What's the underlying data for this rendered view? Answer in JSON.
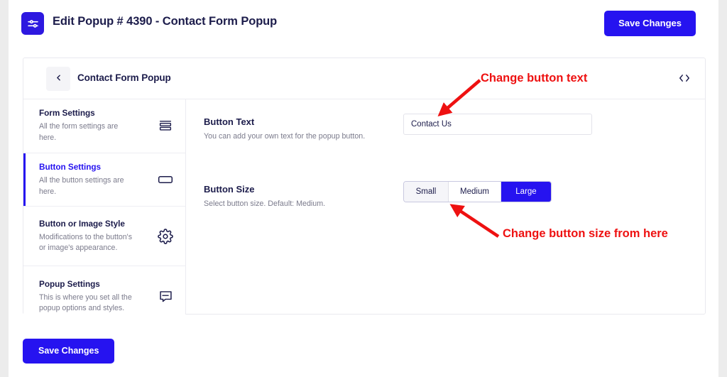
{
  "header": {
    "app_icon": "sliders-icon",
    "title": "Edit Popup # 4390 - Contact Form Popup",
    "save_label": "Save Changes"
  },
  "card": {
    "back_icon": "chevron-left-icon",
    "title": "Contact Form Popup",
    "code_icon": "code-brackets-icon"
  },
  "sidebar": {
    "items": [
      {
        "title": "Form Settings",
        "desc": "All the form settings are here.",
        "icon": "form-lines-icon",
        "active": false
      },
      {
        "title": "Button Settings",
        "desc": "All the button settings are here.",
        "icon": "button-rectangle-icon",
        "active": true
      },
      {
        "title": "Button or Image Style",
        "desc": "Modifications to the button's or image's appearance.",
        "icon": "gear-icon",
        "active": false
      },
      {
        "title": "Popup Settings",
        "desc": "This is where you set all the popup options and styles.",
        "icon": "message-bubble-icon",
        "active": false
      }
    ]
  },
  "settings": {
    "button_text": {
      "title": "Button Text",
      "desc": "You can add your own text for the popup button.",
      "value": "Contact Us",
      "placeholder": "Contact Us"
    },
    "button_size": {
      "title": "Button Size",
      "desc": "Select button size. Default: Medium.",
      "options": [
        "Small",
        "Medium",
        "Large"
      ],
      "selected": "Large"
    }
  },
  "footer": {
    "save_label": "Save Changes"
  },
  "annotations": [
    {
      "text": "Change button text",
      "color": "#ee1111"
    },
    {
      "text": "Change button size from here",
      "color": "#ee1111"
    }
  ],
  "colors": {
    "brand_blue": "#2613f0",
    "title_navy": "#1c1c4b",
    "muted_gray": "#7b7b8c",
    "annotation_red": "#ee1111",
    "page_bg": "#ececec"
  }
}
